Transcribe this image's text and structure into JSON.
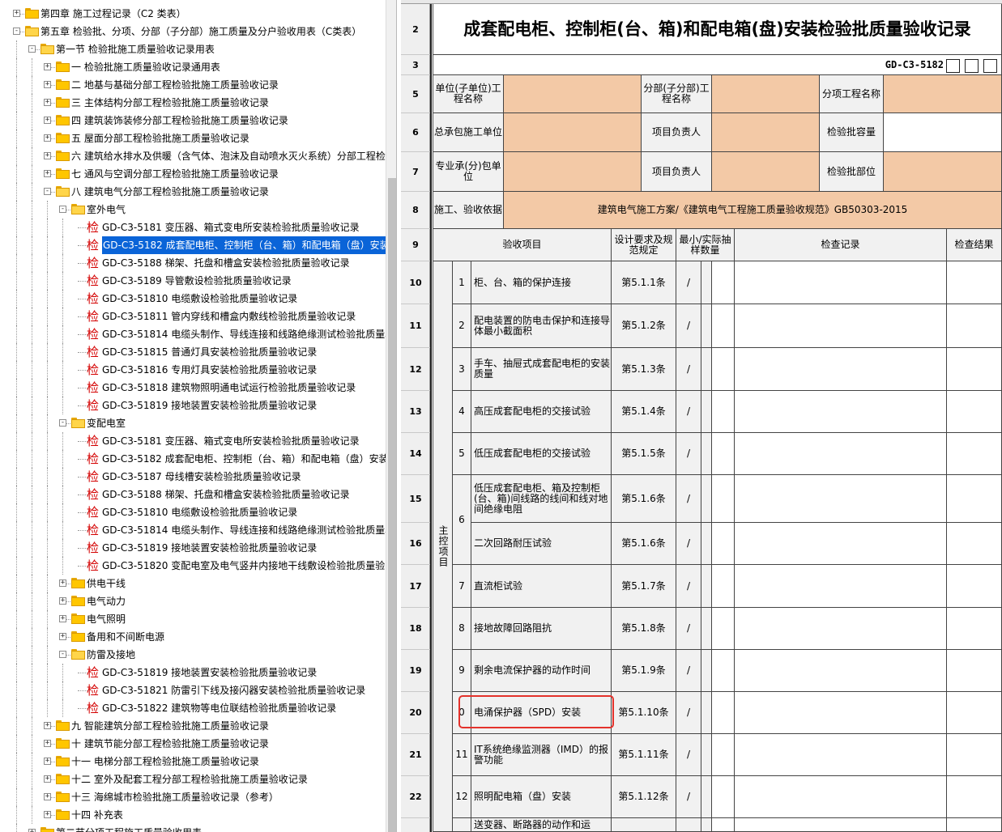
{
  "tree": {
    "items": [
      {
        "label": "第四章 施工过程记录（C2 类表）",
        "icon": "folder-icon",
        "expander": "+"
      },
      {
        "label": "第五章 检验批、分项、分部（子分部）施工质量及分户验收用表（C类表）",
        "icon": "folder-open-icon",
        "expander": "-"
      },
      {
        "label": "第一节 检验批施工质量验收记录用表",
        "icon": "folder-open-icon",
        "expander": "-"
      },
      {
        "label": "一 检验批施工质量验收记录通用表",
        "icon": "folder-icon",
        "expander": "+"
      },
      {
        "label": "二 地基与基础分部工程检验批施工质量验收记录",
        "icon": "folder-icon",
        "expander": "+"
      },
      {
        "label": "三 主体结构分部工程检验批施工质量验收记录",
        "icon": "folder-icon",
        "expander": "+"
      },
      {
        "label": "四 建筑装饰装修分部工程检验批施工质量验收记录",
        "icon": "folder-icon",
        "expander": "+"
      },
      {
        "label": "五 屋面分部工程检验批施工质量验收记录",
        "icon": "folder-icon",
        "expander": "+"
      },
      {
        "label": "六 建筑给水排水及供暖（含气体、泡沫及自动喷水灭火系统）分部工程检",
        "icon": "folder-icon",
        "expander": "+"
      },
      {
        "label": "七 通风与空调分部工程检验批施工质量验收记录",
        "icon": "folder-icon",
        "expander": "+"
      },
      {
        "label": "八 建筑电气分部工程检验批施工质量验收记录",
        "icon": "folder-open-icon",
        "expander": "-"
      },
      {
        "label": "室外电气",
        "icon": "folder-open-icon",
        "expander": "-"
      },
      {
        "label": "GD-C3-5181 变压器、箱式变电所安装检验批质量验收记录",
        "icon": "jian"
      },
      {
        "label": "GD-C3-5182 成套配电柜、控制柜（台、箱）和配电箱（盘）安装检",
        "icon": "jian",
        "selected": true
      },
      {
        "label": "GD-C3-5188 梯架、托盘和槽盒安装检验批质量验收记录",
        "icon": "jian"
      },
      {
        "label": "GD-C3-5189 导管敷设检验批质量验收记录",
        "icon": "jian"
      },
      {
        "label": "GD-C3-51810 电缆敷设检验批质量验收记录",
        "icon": "jian"
      },
      {
        "label": "GD-C3-51811 管内穿线和槽盒内敷线检验批质量验收记录",
        "icon": "jian"
      },
      {
        "label": "GD-C3-51814 电缆头制作、导线连接和线路绝缘测试检验批质量验",
        "icon": "jian"
      },
      {
        "label": "GD-C3-51815 普通灯具安装检验批质量验收记录",
        "icon": "jian"
      },
      {
        "label": "GD-C3-51816 专用灯具安装检验批质量验收记录",
        "icon": "jian"
      },
      {
        "label": "GD-C3-51818 建筑物照明通电试运行检验批质量验收记录",
        "icon": "jian"
      },
      {
        "label": "GD-C3-51819 接地装置安装检验批质量验收记录",
        "icon": "jian"
      },
      {
        "label": "变配电室",
        "icon": "folder-open-icon",
        "expander": "-"
      },
      {
        "label": "GD-C3-5181 变压器、箱式变电所安装检验批质量验收记录",
        "icon": "jian"
      },
      {
        "label": "GD-C3-5182 成套配电柜、控制柜（台、箱）和配电箱（盘）安装检",
        "icon": "jian"
      },
      {
        "label": "GD-C3-5187 母线槽安装检验批质量验收记录",
        "icon": "jian"
      },
      {
        "label": "GD-C3-5188 梯架、托盘和槽盒安装检验批质量验收记录",
        "icon": "jian"
      },
      {
        "label": "GD-C3-51810 电缆敷设检验批质量验收记录",
        "icon": "jian"
      },
      {
        "label": "GD-C3-51814 电缆头制作、导线连接和线路绝缘测试检验批质量验",
        "icon": "jian"
      },
      {
        "label": "GD-C3-51819 接地装置安装检验批质量验收记录",
        "icon": "jian"
      },
      {
        "label": "GD-C3-51820 变配电室及电气竖井内接地干线敷设检验批质量验收",
        "icon": "jian"
      },
      {
        "label": "供电干线",
        "icon": "folder-icon",
        "expander": "+"
      },
      {
        "label": "电气动力",
        "icon": "folder-icon",
        "expander": "+"
      },
      {
        "label": "电气照明",
        "icon": "folder-icon",
        "expander": "+"
      },
      {
        "label": "备用和不间断电源",
        "icon": "folder-icon",
        "expander": "+"
      },
      {
        "label": "防雷及接地",
        "icon": "folder-open-icon",
        "expander": "-"
      },
      {
        "label": "GD-C3-51819 接地装置安装检验批质量验收记录",
        "icon": "jian"
      },
      {
        "label": "GD-C3-51821 防雷引下线及接闪器安装检验批质量验收记录",
        "icon": "jian"
      },
      {
        "label": "GD-C3-51822 建筑物等电位联结检验批质量验收记录",
        "icon": "jian"
      },
      {
        "label": "九 智能建筑分部工程检验批施工质量验收记录",
        "icon": "folder-icon",
        "expander": "+"
      },
      {
        "label": "十 建筑节能分部工程检验批施工质量验收记录",
        "icon": "folder-icon",
        "expander": "+"
      },
      {
        "label": "十一 电梯分部工程检验批施工质量验收记录",
        "icon": "folder-icon",
        "expander": "+"
      },
      {
        "label": "十二 室外及配套工程分部工程检验批施工质量验收记录",
        "icon": "folder-icon",
        "expander": "+"
      },
      {
        "label": "十三 海绵城市检验批施工质量验收记录（参考）",
        "icon": "folder-icon",
        "expander": "+"
      },
      {
        "label": "十四 补充表",
        "icon": "folder-icon",
        "expander": "+"
      },
      {
        "label": "第二节分项工程施工质量验收用表",
        "icon": "folder-icon",
        "expander": "+"
      }
    ],
    "jian_char": "检"
  },
  "sheet": {
    "row_numbers": [
      "2",
      "3",
      "5",
      "6",
      "7",
      "8",
      "9",
      "10",
      "11",
      "12",
      "13",
      "14",
      "15",
      "16",
      "17",
      "18",
      "19",
      "20",
      "21",
      "22"
    ],
    "title": "成套配电柜、控制柜(台、箱)和配电箱(盘)安装检验批质量验收记录",
    "code": "GD-C3-5182",
    "header": {
      "unit_label": "单位(子单位)工程名称",
      "sub_label": "分部(子分部)工程名称",
      "item_label": "分项工程名称",
      "general_label": "总承包施工单位",
      "manager1_label": "项目负责人",
      "capacity_label": "检验批容量",
      "specialty_label": "专业承(分)包单位",
      "manager2_label": "项目负责人",
      "location_label": "检验批部位",
      "basis_label": "施工、验收依据",
      "basis_value": "建筑电气施工方案/《建筑电气工程施工质量验收规范》GB50303-2015"
    },
    "cols": {
      "item": "验收项目",
      "design": "设计要求及规范规定",
      "sample": "最小/实际抽样数量",
      "record": "检查记录",
      "result": "检查结果"
    },
    "main_label": "主控项目",
    "items": [
      {
        "no": "1",
        "text": "柜、台、箱的保护连接",
        "clause": "第5.1.1条",
        "sample": "/"
      },
      {
        "no": "2",
        "text": "配电装置的防电击保护和连接导体最小截面积",
        "clause": "第5.1.2条",
        "sample": "/"
      },
      {
        "no": "3",
        "text": "手车、抽屉式成套配电柜的安装质量",
        "clause": "第5.1.3条",
        "sample": "/"
      },
      {
        "no": "4",
        "text": "高压成套配电柜的交接试验",
        "clause": "第5.1.4条",
        "sample": "/"
      },
      {
        "no": "5",
        "text": "低压成套配电柜的交接试验",
        "clause": "第5.1.5条",
        "sample": "/"
      },
      {
        "no": "6",
        "text": "低压成套配电柜、箱及控制柜(台、箱)间线路的线间和线对地间绝缘电阻",
        "clause": "第5.1.6条",
        "sample": "/"
      },
      {
        "no": "",
        "text": "二次回路耐压试验",
        "clause": "第5.1.6条",
        "sample": "/"
      },
      {
        "no": "7",
        "text": "直流柜试验",
        "clause": "第5.1.7条",
        "sample": "/"
      },
      {
        "no": "8",
        "text": "接地故障回路阻抗",
        "clause": "第5.1.8条",
        "sample": "/"
      },
      {
        "no": "9",
        "text": "剩余电流保护器的动作时间",
        "clause": "第5.1.9条",
        "sample": "/"
      },
      {
        "no": "0",
        "text": "电涌保护器（SPD）安装",
        "clause": "第5.1.10条",
        "sample": "/"
      },
      {
        "no": "11",
        "text": "IT系统绝缘监测器（IMD）的报警功能",
        "clause": "第5.1.11条",
        "sample": "/"
      },
      {
        "no": "12",
        "text": "照明配电箱（盘）安装",
        "clause": "第5.1.12条",
        "sample": "/"
      },
      {
        "no": "",
        "text": "送变器、断路器的动作和运",
        "clause": "",
        "sample": ""
      }
    ]
  }
}
